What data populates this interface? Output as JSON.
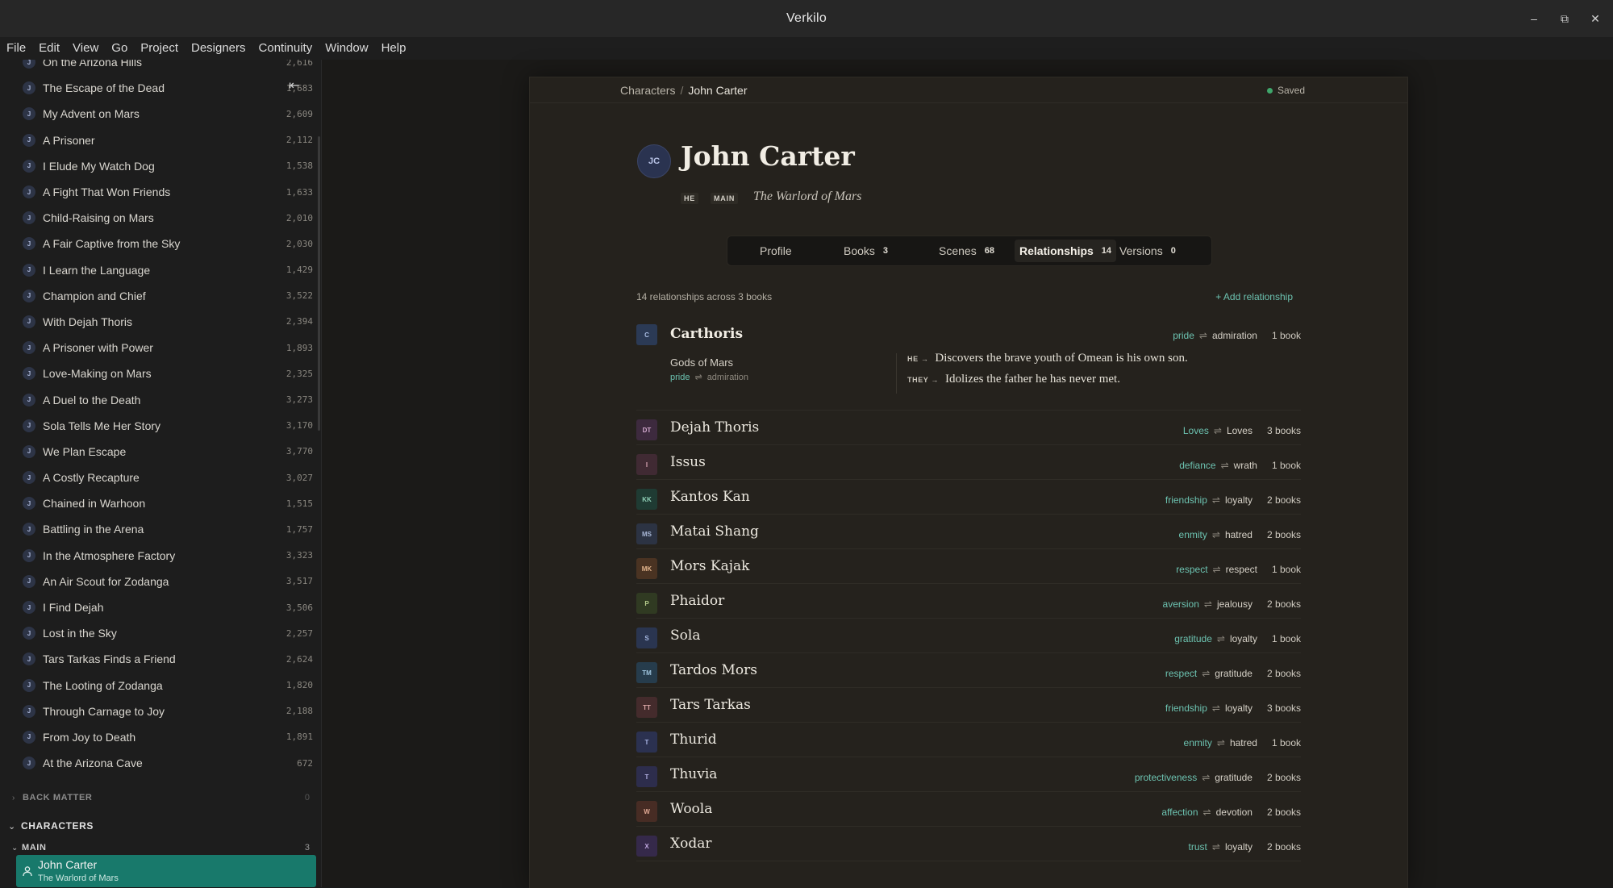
{
  "window": {
    "title": "Verkilo",
    "controls": [
      "–",
      "⧉",
      "✕"
    ]
  },
  "menu": [
    "File",
    "Edit",
    "View",
    "Go",
    "Project",
    "Designers",
    "Continuity",
    "Window",
    "Help"
  ],
  "sidebar": {
    "chapters": [
      {
        "badge": "J",
        "title": "On the Arizona Hills",
        "words": "2,616"
      },
      {
        "badge": "J",
        "title": "The Escape of the Dead",
        "words": "1,683"
      },
      {
        "badge": "J",
        "title": "My Advent on Mars",
        "words": "2,609"
      },
      {
        "badge": "J",
        "title": "A Prisoner",
        "words": "2,112"
      },
      {
        "badge": "J",
        "title": "I Elude My Watch Dog",
        "words": "1,538"
      },
      {
        "badge": "J",
        "title": "A Fight That Won Friends",
        "words": "1,633"
      },
      {
        "badge": "J",
        "title": "Child-Raising on Mars",
        "words": "2,010"
      },
      {
        "badge": "J",
        "title": "A Fair Captive from the Sky",
        "words": "2,030"
      },
      {
        "badge": "J",
        "title": "I Learn the Language",
        "words": "1,429"
      },
      {
        "badge": "J",
        "title": "Champion and Chief",
        "words": "3,522"
      },
      {
        "badge": "J",
        "title": "With Dejah Thoris",
        "words": "2,394"
      },
      {
        "badge": "J",
        "title": "A Prisoner with Power",
        "words": "1,893"
      },
      {
        "badge": "J",
        "title": "Love-Making on Mars",
        "words": "2,325"
      },
      {
        "badge": "J",
        "title": "A Duel to the Death",
        "words": "3,273"
      },
      {
        "badge": "J",
        "title": "Sola Tells Me Her Story",
        "words": "3,170"
      },
      {
        "badge": "J",
        "title": "We Plan Escape",
        "words": "3,770"
      },
      {
        "badge": "J",
        "title": "A Costly Recapture",
        "words": "3,027"
      },
      {
        "badge": "J",
        "title": "Chained in Warhoon",
        "words": "1,515"
      },
      {
        "badge": "J",
        "title": "Battling in the Arena",
        "words": "1,757"
      },
      {
        "badge": "J",
        "title": "In the Atmosphere Factory",
        "words": "3,323"
      },
      {
        "badge": "J",
        "title": "An Air Scout for Zodanga",
        "words": "3,517"
      },
      {
        "badge": "J",
        "title": "I Find Dejah",
        "words": "3,506"
      },
      {
        "badge": "J",
        "title": "Lost in the Sky",
        "words": "2,257"
      },
      {
        "badge": "J",
        "title": "Tars Tarkas Finds a Friend",
        "words": "2,624"
      },
      {
        "badge": "J",
        "title": "The Looting of Zodanga",
        "words": "1,820"
      },
      {
        "badge": "J",
        "title": "Through Carnage to Joy",
        "words": "2,188"
      },
      {
        "badge": "J",
        "title": "From Joy to Death",
        "words": "1,891"
      },
      {
        "badge": "J",
        "title": "At the Arizona Cave",
        "words": "672"
      }
    ],
    "back_matter": {
      "label": "BACK MATTER",
      "count": "0"
    },
    "characters": {
      "label": "CHARACTERS"
    },
    "main_group": {
      "label": "MAIN",
      "count": "3"
    },
    "active_character": {
      "name": "John Carter",
      "subtitle": "The Warlord of Mars"
    }
  },
  "breadcrumb": {
    "root": "Characters",
    "separator": "/",
    "current": "John Carter"
  },
  "status": {
    "text": "Saved",
    "color": "#3fa66b"
  },
  "character": {
    "initials": "JC",
    "name": "John Carter",
    "pronoun_tag": "HE",
    "role_tag": "MAIN",
    "subtitle": "The Warlord of Mars"
  },
  "tabs": [
    {
      "label": "Profile",
      "count": ""
    },
    {
      "label": "Books",
      "count": "3"
    },
    {
      "label": "Scenes",
      "count": "68"
    },
    {
      "label": "Relationships",
      "count": "14",
      "active": true
    },
    {
      "label": "Versions",
      "count": "0"
    }
  ],
  "relationships": {
    "summary": "14 relationships across 3 books",
    "add_label": "+ Add relationship",
    "expanded": {
      "initials": "C",
      "name": "Carthoris",
      "from": "pride",
      "arrow": "⇌",
      "to": "admiration",
      "books": "1 book",
      "book_title": "Gods of Mars",
      "book_from": "pride",
      "book_to": "admiration",
      "lines": [
        {
          "who": "HE",
          "arrow": "→",
          "text": "Discovers the brave youth of Omean is his own son."
        },
        {
          "who": "THEY",
          "arrow": "→",
          "text": "Idolizes the father he has never met."
        }
      ]
    },
    "items": [
      {
        "initials": "DT",
        "name": "Dejah Thoris",
        "from": "Loves",
        "to": "Loves",
        "books": "3 books",
        "color": "#3d2a3e",
        "text_color": "#d3a9cf"
      },
      {
        "initials": "I",
        "name": "Issus",
        "from": "defiance",
        "to": "wrath",
        "books": "1 book",
        "color": "#402a33",
        "text_color": "#d7a4b3"
      },
      {
        "initials": "KK",
        "name": "Kantos Kan",
        "from": "friendship",
        "to": "loyalty",
        "books": "2 books",
        "color": "#1f3b33",
        "text_color": "#8fd0b7"
      },
      {
        "initials": "MS",
        "name": "Matai Shang",
        "from": "enmity",
        "to": "hatred",
        "books": "2 books",
        "color": "#2c3343",
        "text_color": "#a8b7d6"
      },
      {
        "initials": "MK",
        "name": "Mors Kajak",
        "from": "respect",
        "to": "respect",
        "books": "1 book",
        "color": "#4a3322",
        "text_color": "#e0b28a"
      },
      {
        "initials": "P",
        "name": "Phaidor",
        "from": "aversion",
        "to": "jealousy",
        "books": "2 books",
        "color": "#303a22",
        "text_color": "#b9cf8e"
      },
      {
        "initials": "S",
        "name": "Sola",
        "from": "gratitude",
        "to": "loyalty",
        "books": "1 book",
        "color": "#2a3550",
        "text_color": "#a6b8e2"
      },
      {
        "initials": "TM",
        "name": "Tardos Mors",
        "from": "respect",
        "to": "gratitude",
        "books": "2 books",
        "color": "#263c4c",
        "text_color": "#9fc6df"
      },
      {
        "initials": "TT",
        "name": "Tars Tarkas",
        "from": "friendship",
        "to": "loyalty",
        "books": "3 books",
        "color": "#442b2c",
        "text_color": "#dca8a8"
      },
      {
        "initials": "T",
        "name": "Thurid",
        "from": "enmity",
        "to": "hatred",
        "books": "1 book",
        "color": "#2b3150",
        "text_color": "#a9b3e3"
      },
      {
        "initials": "T",
        "name": "Thuvia",
        "from": "protectiveness",
        "to": "gratitude",
        "books": "2 books",
        "color": "#2d2d4c",
        "text_color": "#b1afe0"
      },
      {
        "initials": "W",
        "name": "Woola",
        "from": "affection",
        "to": "devotion",
        "books": "2 books",
        "color": "#472c24",
        "text_color": "#e2aa95"
      },
      {
        "initials": "X",
        "name": "Xodar",
        "from": "trust",
        "to": "loyalty",
        "books": "2 books",
        "color": "#35294a",
        "text_color": "#c0a8e0"
      }
    ]
  },
  "colors": {
    "accent": "#6cc2b0",
    "active_sidebar": "#18796b",
    "card": "#25221d"
  },
  "icons": {
    "collapse": "collapse-sidebar-icon"
  }
}
